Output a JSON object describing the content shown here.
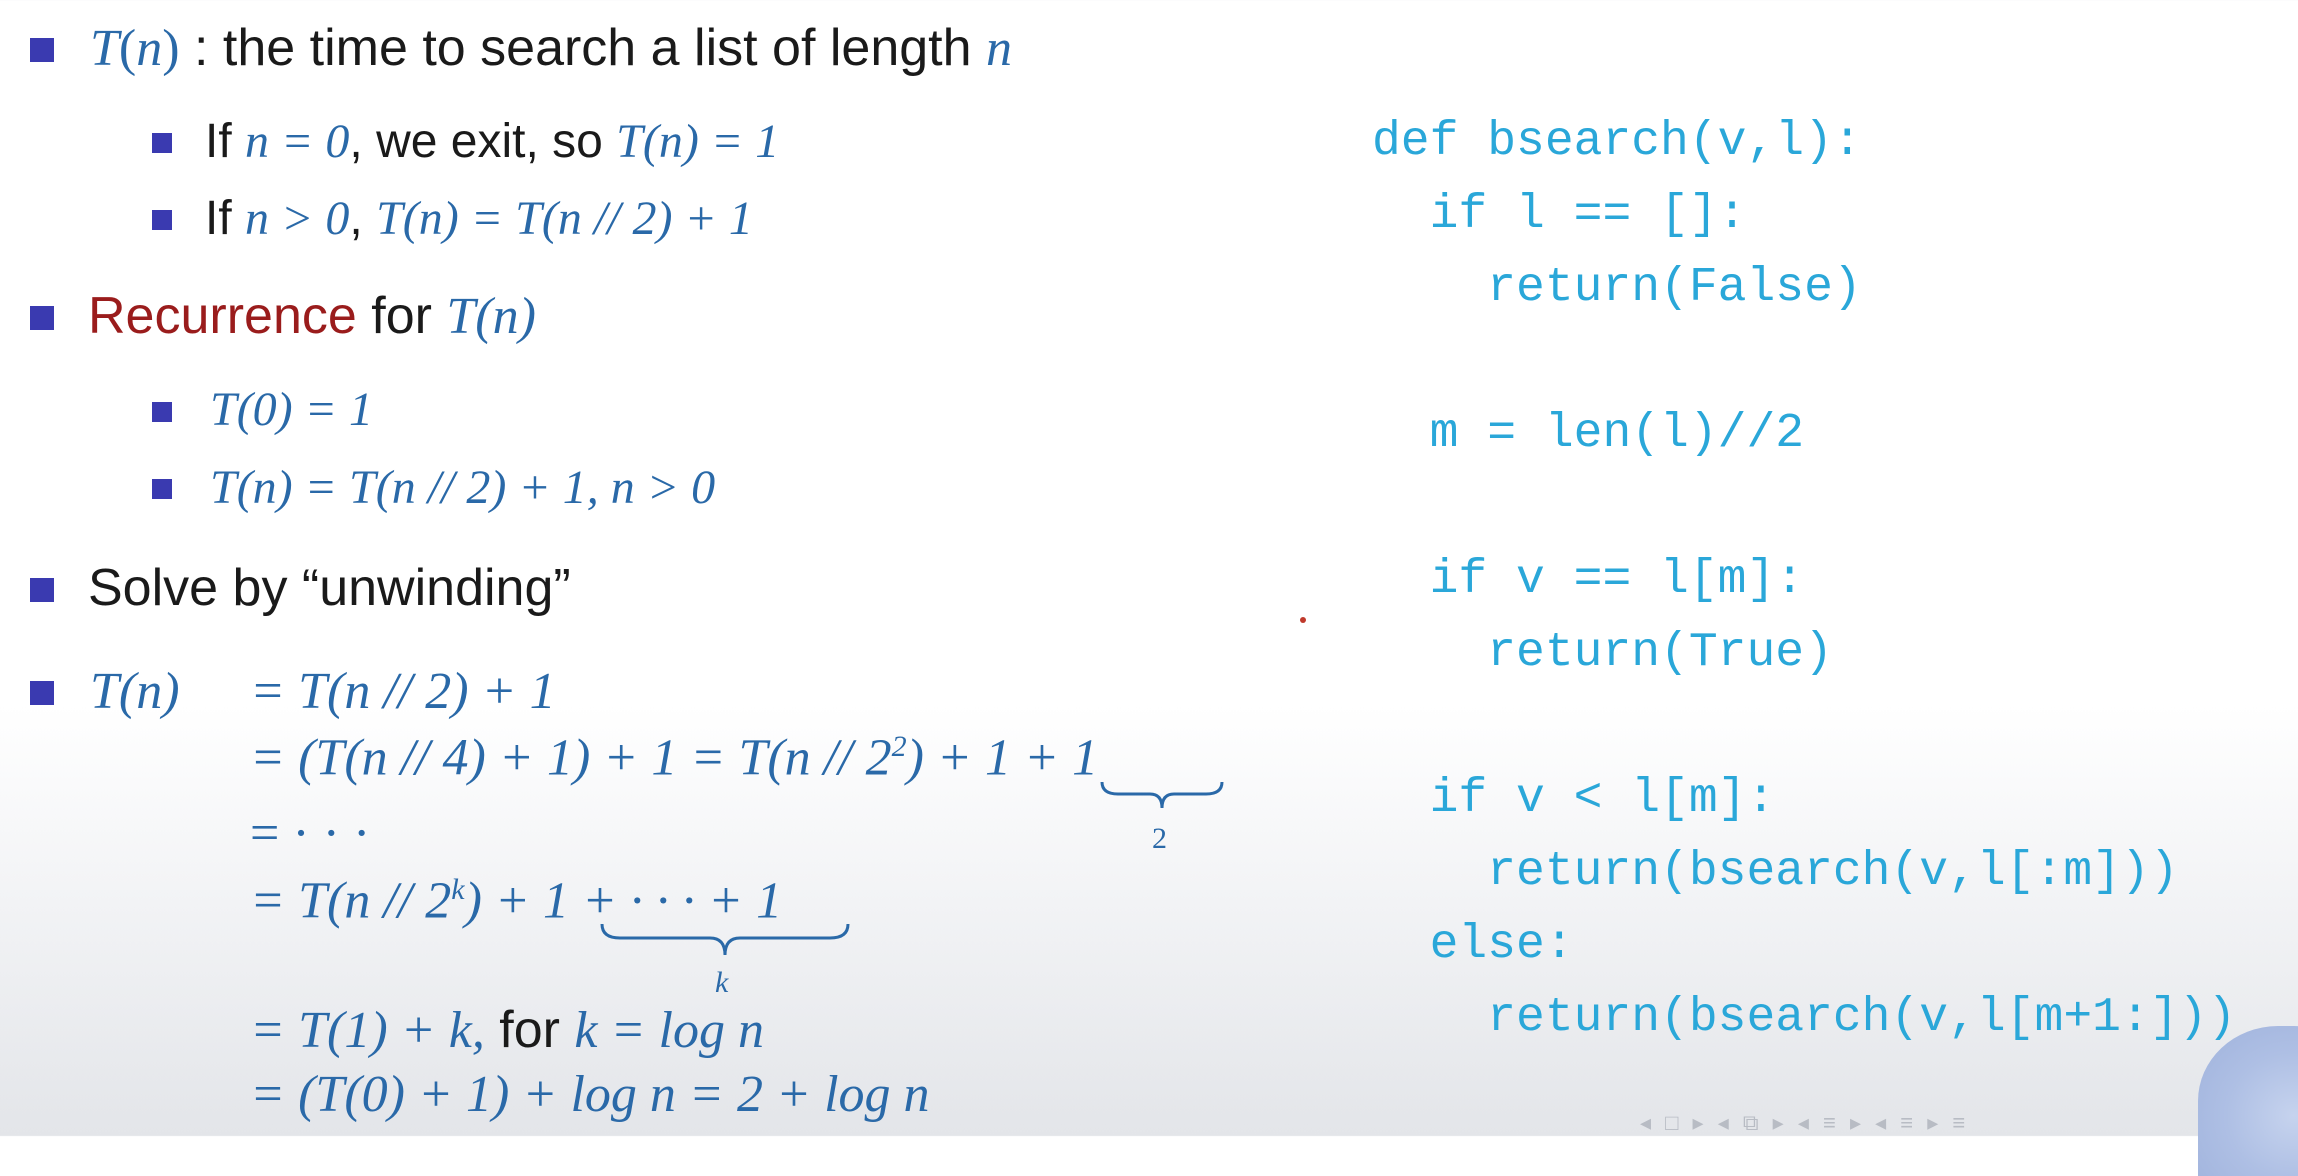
{
  "bullets": {
    "b1": {
      "func": "T",
      "arg": "n",
      "text": " : the time to search a list of length ",
      "var": "n"
    },
    "b1_sub1": {
      "if": "If ",
      "cond": "n = 0",
      "mid": ", we exit, so ",
      "res": "T(n) = 1"
    },
    "b1_sub2": {
      "if": "If ",
      "cond": "n > 0",
      "sep": ", ",
      "res": "T(n) = T(n // 2) + 1"
    },
    "b2": {
      "word": "Recurrence",
      "rest": " for ",
      "math": "T(n)"
    },
    "b2_sub1": "T(0) = 1",
    "b2_sub2": "T(n) = T(n // 2) + 1, n > 0",
    "b3": "Solve by “unwinding”",
    "b4": {
      "lhs": "T(n)",
      "line1": "= T(n // 2) + 1",
      "line2a": "= (T(n // 4) + 1) + 1 = T(n // 2",
      "line2_sup": "2",
      "line2b": ") + ",
      "line2_brace": "1 + 1",
      "brace1_label": "2",
      "line3": "= · · ·",
      "line4a": "= T(n // 2",
      "line4_sup": "k",
      "line4b": ") + ",
      "line4_brace": "1 + · · · + 1",
      "brace2_label": "k",
      "line5a": "= T(1) + k,",
      "line5_for": " for ",
      "line5b": "k = log n",
      "line6": "= (T(0) + 1) + log n = 2 + log n"
    }
  },
  "code": {
    "lines": [
      "def bsearch(v,l):",
      "  if l == []:",
      "    return(False)",
      "",
      "  m = len(l)//2",
      "",
      "  if v == l[m]:",
      "    return(True)",
      "",
      "  if v < l[m]:",
      "    return(bsearch(v,l[:m]))",
      "  else:",
      "    return(bsearch(v,l[m+1:]))"
    ]
  },
  "nav": {
    "symbols": "◂ □ ▸ ◂ ⧉ ▸ ◂ ≡ ▸ ◂ ≡ ▸     ≡"
  },
  "colors": {
    "bullet": "#3a3ab0",
    "math": "#2a69a8",
    "code": "#2aa7d9",
    "accent_red": "#9a1c1c"
  }
}
